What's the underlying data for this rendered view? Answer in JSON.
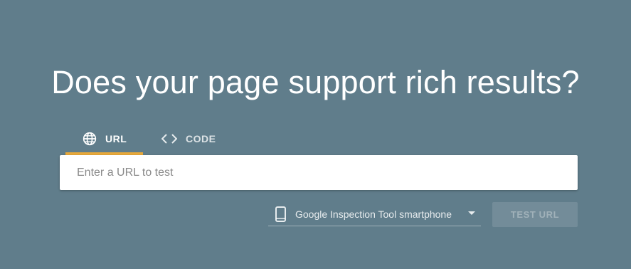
{
  "headline": "Does your page support rich results?",
  "tabs": [
    {
      "label": "URL",
      "icon": "globe-icon",
      "active": true
    },
    {
      "label": "CODE",
      "icon": "code-icon",
      "active": false
    }
  ],
  "url_input": {
    "placeholder": "Enter a URL to test",
    "value": ""
  },
  "device_select": {
    "icon": "smartphone-icon",
    "selected": "Google Inspection Tool smartphone"
  },
  "test_button": {
    "label": "TEST URL",
    "enabled": false
  },
  "colors": {
    "background": "#607d8b",
    "active_tab_indicator": "#e8a93a",
    "input_background": "#ffffff"
  }
}
